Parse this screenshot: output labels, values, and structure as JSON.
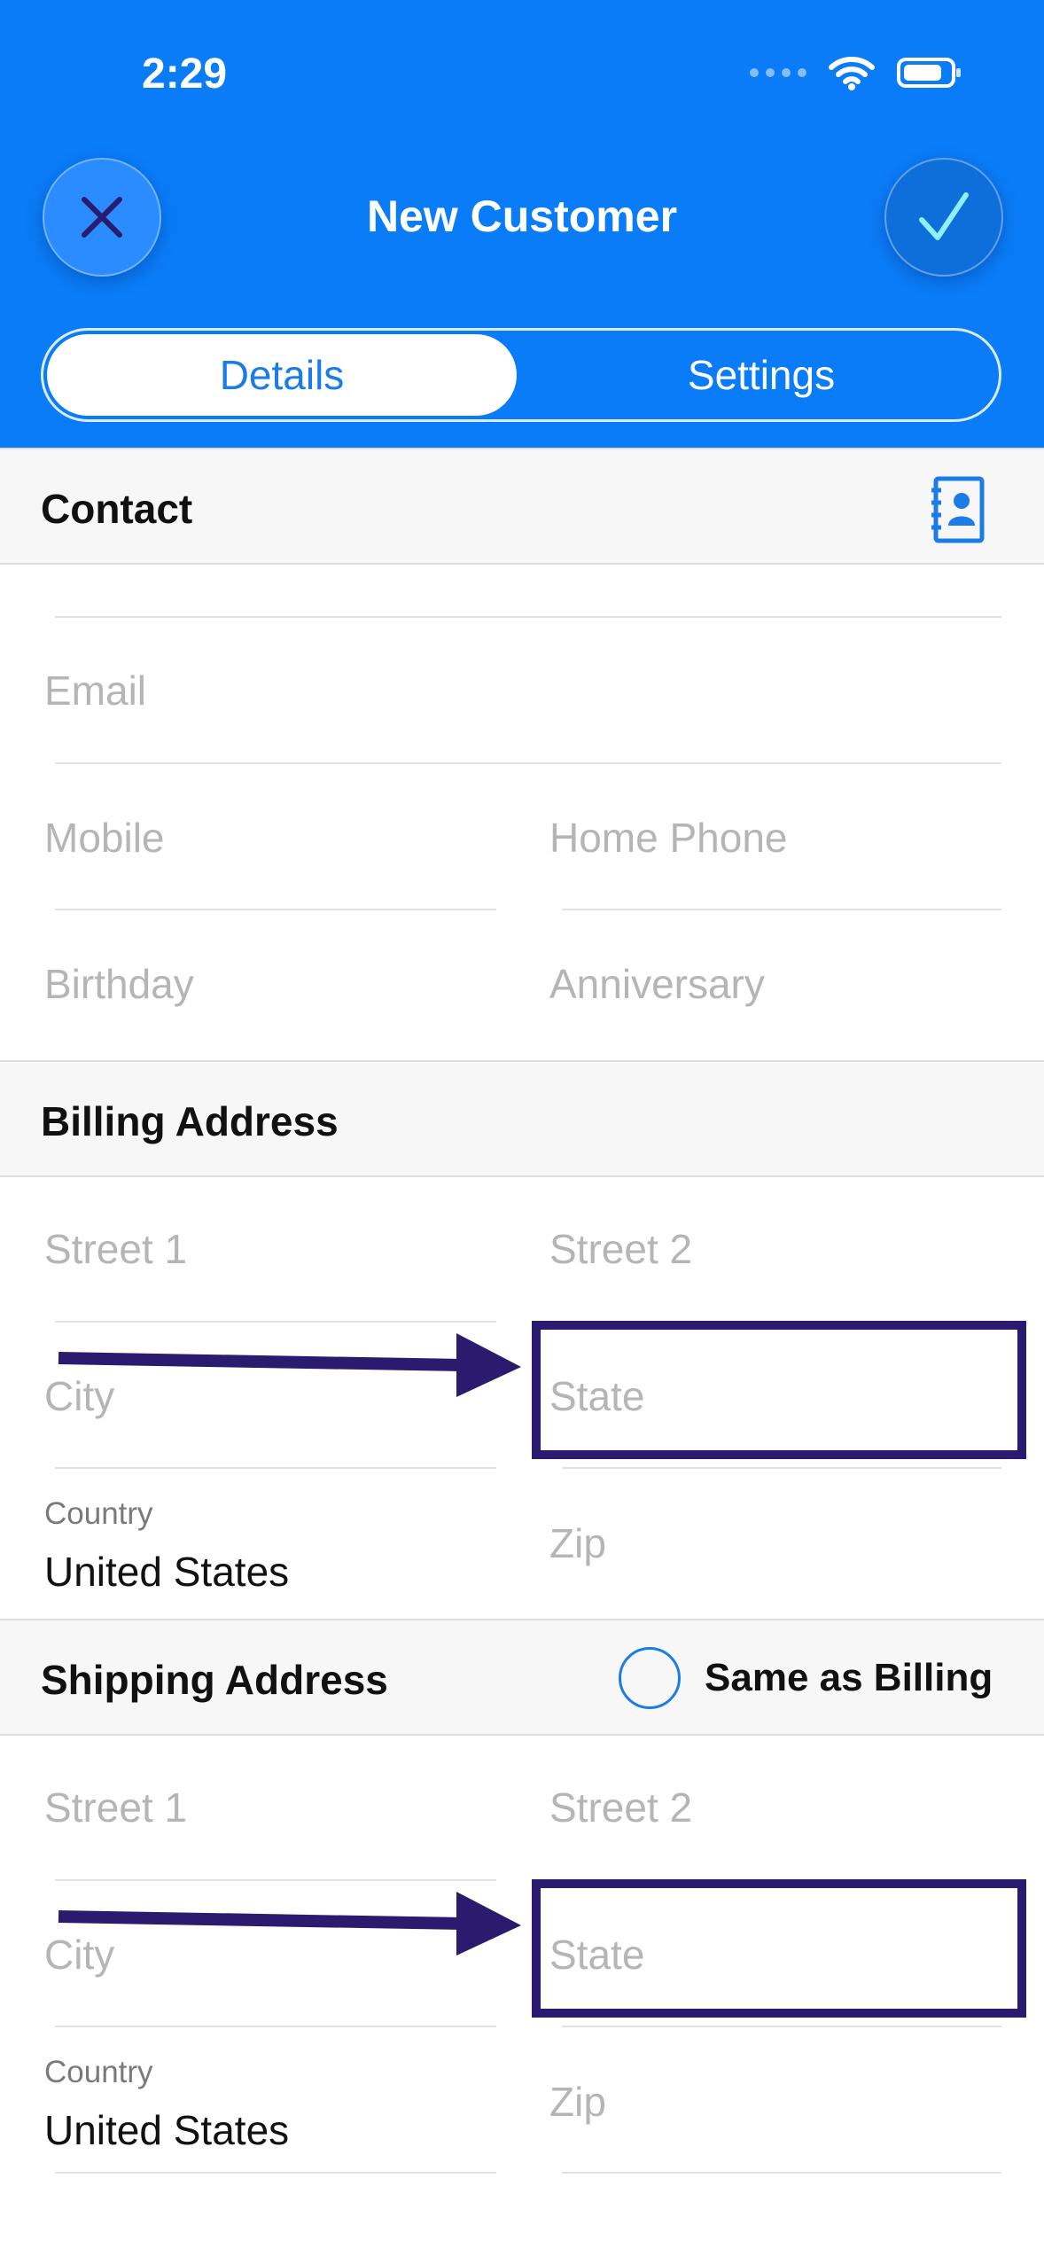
{
  "status": {
    "time": "2:29"
  },
  "header": {
    "title": "New Customer",
    "tabs": [
      {
        "label": "Details"
      },
      {
        "label": "Settings"
      }
    ]
  },
  "contact": {
    "title": "Contact",
    "fields": {
      "email": "Email",
      "mobile": "Mobile",
      "home_phone": "Home Phone",
      "birthday": "Birthday",
      "anniversary": "Anniversary"
    }
  },
  "billing": {
    "title": "Billing Address",
    "street1": "Street 1",
    "street2": "Street 2",
    "city": "City",
    "state": "State",
    "country_label": "Country",
    "country_value": "United States",
    "zip": "Zip"
  },
  "shipping": {
    "title": "Shipping Address",
    "same_as_billing": "Same as Billing",
    "street1": "Street 1",
    "street2": "Street 2",
    "city": "City",
    "state": "State",
    "country_label": "Country",
    "country_value": "United States",
    "zip": "Zip"
  },
  "colors": {
    "accent": "#0a7cf7",
    "annotation": "#2a1b6e"
  }
}
